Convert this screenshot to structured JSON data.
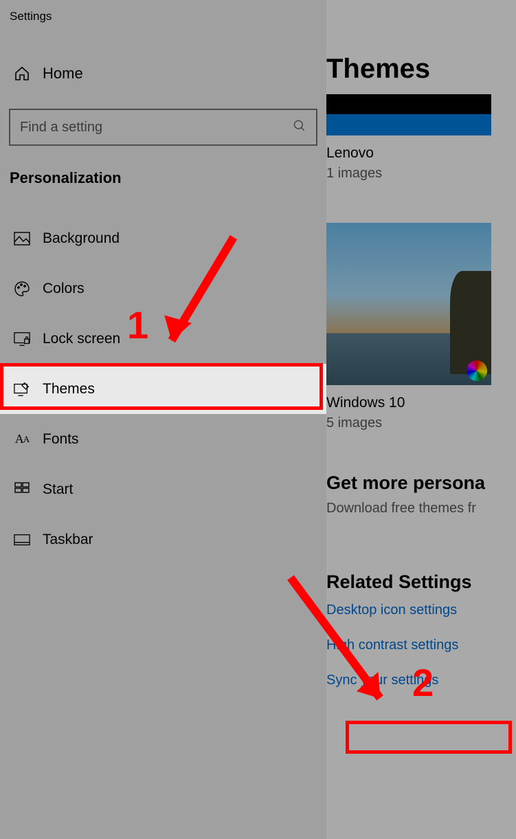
{
  "window_title": "Settings",
  "home_label": "Home",
  "search": {
    "placeholder": "Find a setting"
  },
  "section": "Personalization",
  "nav": [
    {
      "key": "background",
      "label": "Background"
    },
    {
      "key": "colors",
      "label": "Colors"
    },
    {
      "key": "lockscreen",
      "label": "Lock screen"
    },
    {
      "key": "themes",
      "label": "Themes",
      "selected": true
    },
    {
      "key": "fonts",
      "label": "Fonts"
    },
    {
      "key": "start",
      "label": "Start"
    },
    {
      "key": "taskbar",
      "label": "Taskbar"
    }
  ],
  "page_title": "Themes",
  "themes": [
    {
      "name": "Lenovo",
      "sub": "1 images"
    },
    {
      "name": "Windows 10",
      "sub": "5 images"
    }
  ],
  "store": {
    "heading": "Get more persona",
    "sub": "Download free themes fr"
  },
  "related": {
    "heading": "Related Settings",
    "links": [
      "Desktop icon settings",
      "High contrast settings",
      "Sync your settings"
    ]
  },
  "annotations": {
    "step1": "1",
    "step2": "2"
  }
}
